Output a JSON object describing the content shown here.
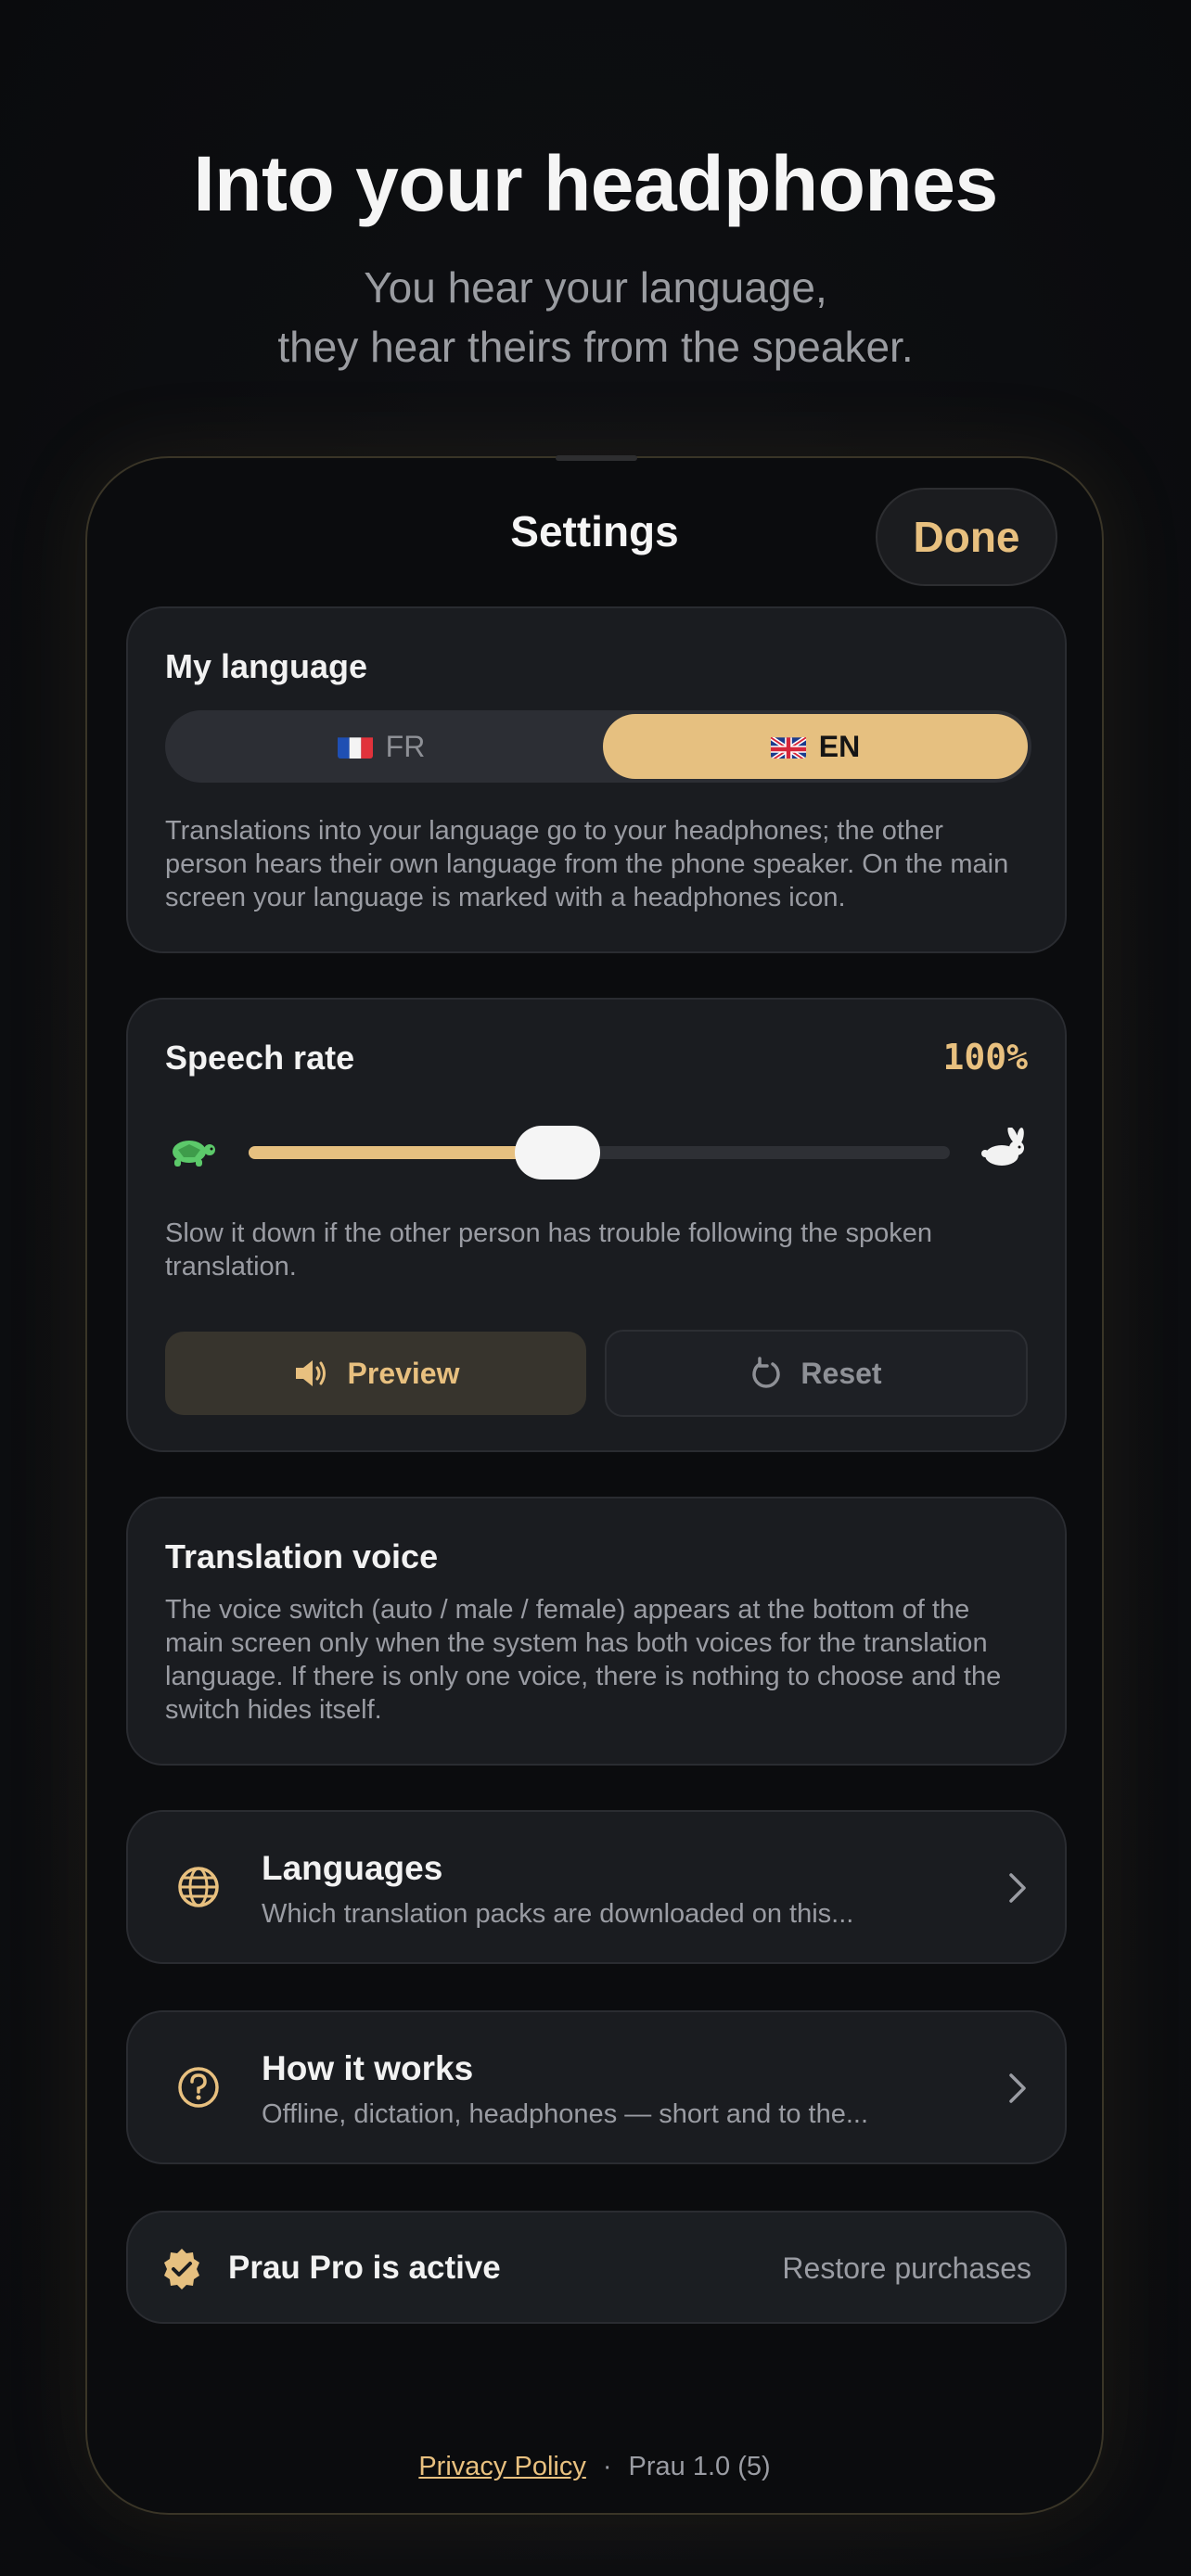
{
  "headline": "Into your headphones",
  "subline": [
    "You hear your language,",
    "they hear theirs from the speaker."
  ],
  "settings": {
    "title": "Settings",
    "done_label": "Done"
  },
  "my_language": {
    "title": "My language",
    "options": [
      {
        "code": "FR",
        "flag": "france-flag-icon",
        "selected": false
      },
      {
        "code": "EN",
        "flag": "uk-flag-icon",
        "selected": true
      }
    ],
    "description": "Translations into your language go to your headphones; the other person hears their own language from the phone speaker. On the main screen your language is marked with a headphones icon."
  },
  "speech_rate": {
    "title": "Speech rate",
    "value_label": "100%",
    "slider_fraction": 0.44,
    "slow_icon": "turtle-icon",
    "fast_icon": "rabbit-icon",
    "description": "Slow it down if the other person has trouble following the spoken translation.",
    "preview_label": "Preview",
    "reset_label": "Reset"
  },
  "translation_voice": {
    "title": "Translation voice",
    "description": "The voice switch (auto / male / female) appears at the bottom of the main screen only when the system has both voices for the translation language. If there is only one voice, there is nothing to choose and the switch hides itself."
  },
  "nav": [
    {
      "icon": "globe-icon",
      "title": "Languages",
      "subtitle": "Which translation packs are downloaded on this..."
    },
    {
      "icon": "help-icon",
      "title": "How it works",
      "subtitle": "Offline, dictation, headphones — short and to the..."
    }
  ],
  "pro": {
    "status": "Prau Pro is active",
    "restore_label": "Restore purchases"
  },
  "footer": {
    "privacy_label": "Privacy Policy",
    "separator": "·",
    "version": "Prau 1.0 (5)"
  },
  "colors": {
    "accent": "#e6c080",
    "background": "#0b0c0e",
    "card": "#1a1c20",
    "turtle": "#5cc96a"
  }
}
